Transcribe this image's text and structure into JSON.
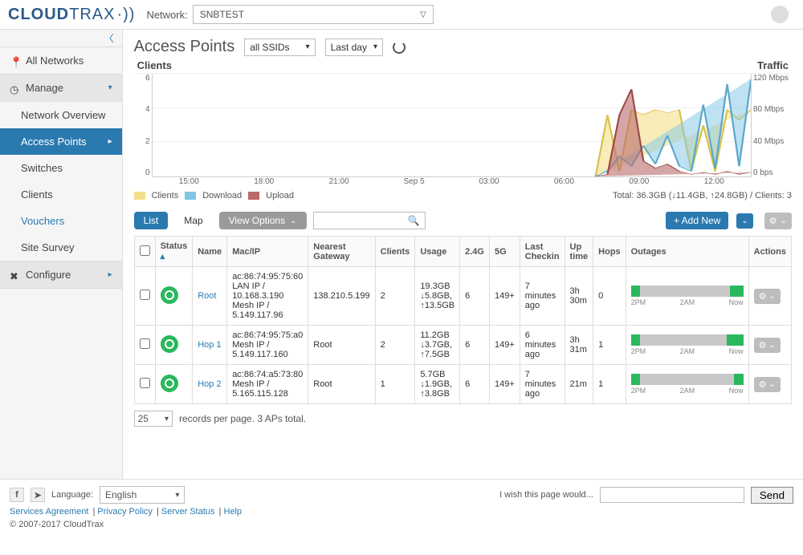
{
  "brand": {
    "part1": "CLOUD",
    "part2": "TRAX"
  },
  "header": {
    "network_label": "Network:",
    "network_value": "SNBTEST"
  },
  "sidebar": {
    "all_networks": "All Networks",
    "manage": "Manage",
    "configure": "Configure",
    "items": [
      "Network Overview",
      "Access Points",
      "Switches",
      "Clients",
      "Vouchers",
      "Site Survey"
    ]
  },
  "page": {
    "title": "Access Points",
    "ssid_filter": "all SSIDs",
    "time_filter": "Last day",
    "clients_label": "Clients",
    "traffic_label": "Traffic"
  },
  "legend": {
    "clients": "Clients",
    "download": "Download",
    "upload": "Upload",
    "totals": "Total: 36.3GB (↓11.4GB, ↑24.8GB) / Clients: 3"
  },
  "chart_data": {
    "type": "line",
    "title": "",
    "x": [
      "15:00",
      "18:00",
      "21:00",
      "Sep 5",
      "03:00",
      "06:00",
      "09:00",
      "12:00"
    ],
    "y_left": {
      "label": "Clients",
      "ticks": [
        0,
        2,
        4,
        6
      ]
    },
    "y_right": {
      "label": "Traffic",
      "ticks": [
        "0 bps",
        "40 Mbps",
        "80 Mbps",
        "120 Mbps"
      ]
    },
    "series": [
      {
        "name": "Clients",
        "color": "#f3e08a",
        "values": [
          0,
          0,
          0,
          0,
          0,
          0,
          0,
          0,
          0,
          0,
          0,
          0,
          3,
          4,
          3,
          4,
          4,
          4,
          2,
          3
        ]
      },
      {
        "name": "Download",
        "color": "#7fc6e6",
        "values": [
          0,
          0,
          0,
          0,
          0,
          0,
          0,
          0,
          0,
          0,
          0,
          0,
          5,
          20,
          10,
          30,
          15,
          40,
          80,
          110
        ]
      },
      {
        "name": "Upload",
        "color": "#b96a6a",
        "values": [
          0,
          0,
          0,
          0,
          0,
          0,
          0,
          0,
          0,
          0,
          0,
          0,
          2,
          60,
          100,
          20,
          10,
          15,
          5,
          10
        ]
      }
    ]
  },
  "tabs": {
    "list": "List",
    "map": "Map",
    "view_options": "View Options",
    "add_new": "+ Add New"
  },
  "table": {
    "headers": [
      "",
      "Status",
      "Name",
      "Mac/IP",
      "Nearest Gateway",
      "Clients",
      "Usage",
      "2.4G",
      "5G",
      "Last Checkin",
      "Up time",
      "Hops",
      "Outages",
      "Actions"
    ],
    "outage_labels": [
      "2PM",
      "2AM",
      "Now"
    ],
    "rows": [
      {
        "name": "Root",
        "mac": "ac:86:74:95:75:60",
        "lan": "LAN IP / 10.168.3.190",
        "mesh": "Mesh IP / 5.149.117.96",
        "gateway": "138.210.5.199",
        "clients": "2",
        "usage": "19.3GB\n↓5.8GB,\n↑13.5GB",
        "g24": "6",
        "g5": "149+",
        "checkin": "7 minutes ago",
        "uptime": "3h 30m",
        "hops": "0",
        "outage_segs": [
          [
            0,
            8
          ],
          [
            88,
            100
          ]
        ]
      },
      {
        "name": "Hop 1",
        "mac": "ac:86:74:95:75:a0",
        "lan": "",
        "mesh": "Mesh IP / 5.149.117.160",
        "gateway": "Root",
        "clients": "2",
        "usage": "11.2GB\n↓3.7GB,\n↑7.5GB",
        "g24": "6",
        "g5": "149+",
        "checkin": "6 minutes ago",
        "uptime": "3h 31m",
        "hops": "1",
        "outage_segs": [
          [
            0,
            8
          ],
          [
            85,
            100
          ]
        ]
      },
      {
        "name": "Hop 2",
        "mac": "ac:86:74:a5:73:80",
        "lan": "",
        "mesh": "Mesh IP / 5.165.115.128",
        "gateway": "Root",
        "clients": "1",
        "usage": "5.7GB\n↓1.9GB,\n↑3.8GB",
        "g24": "6",
        "g5": "149+",
        "checkin": "7 minutes ago",
        "uptime": "21m",
        "hops": "1",
        "outage_segs": [
          [
            0,
            8
          ],
          [
            92,
            100
          ]
        ]
      }
    ]
  },
  "pager": {
    "size": "25",
    "text": "records per page.  3 APs total."
  },
  "footer": {
    "language_label": "Language:",
    "language_value": "English",
    "wish_label": "I wish this page would...",
    "send": "Send",
    "links": [
      "Services Agreement",
      "Privacy Policy",
      "Server Status",
      "Help"
    ],
    "copyright": "© 2007-2017 CloudTrax"
  }
}
